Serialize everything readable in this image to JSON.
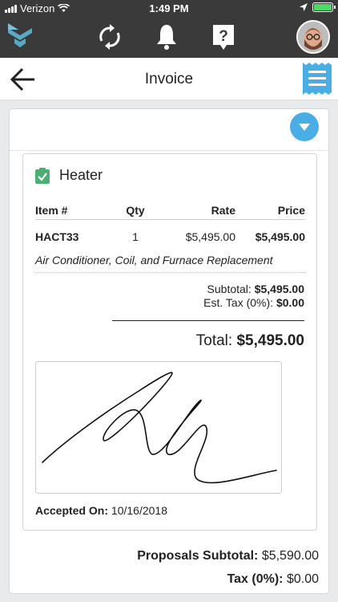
{
  "status_bar": {
    "carrier": "Verizon",
    "time": "1:49 PM"
  },
  "header": {
    "title": "Invoice"
  },
  "section": {
    "title": "Heater",
    "columns": [
      "Item #",
      "Qty",
      "Rate",
      "Price"
    ],
    "items": [
      {
        "item": "HACT33",
        "qty": "1",
        "rate": "$5,495.00",
        "price": "$5,495.00",
        "description": "Air Conditioner, Coil, and Furnace Replacement"
      }
    ],
    "subtotal_label": "Subtotal:",
    "subtotal_value": "$5,495.00",
    "tax_label": "Est. Tax (0%):",
    "tax_value": "$0.00",
    "total_label": "Total:",
    "total_value": "$5,495.00",
    "accepted_label": "Accepted On:",
    "accepted_date": "10/16/2018"
  },
  "footer": {
    "proposals_subtotal_label": "Proposals Subtotal:",
    "proposals_subtotal_value": "$5,590.00",
    "tax_label": "Tax (0%):",
    "tax_value": "$0.00"
  },
  "colors": {
    "accent": "#4aaee6",
    "toolbar": "#3a3a3a",
    "check": "#4caf72",
    "logo": "#5aa8c8"
  },
  "icons": [
    "wifi-icon",
    "location-icon",
    "battery-icon",
    "logo-icon",
    "sync-icon",
    "bell-icon",
    "help-icon",
    "avatar",
    "back-arrow-icon",
    "receipt-icon",
    "chevron-down-icon",
    "clipboard-check-icon"
  ]
}
